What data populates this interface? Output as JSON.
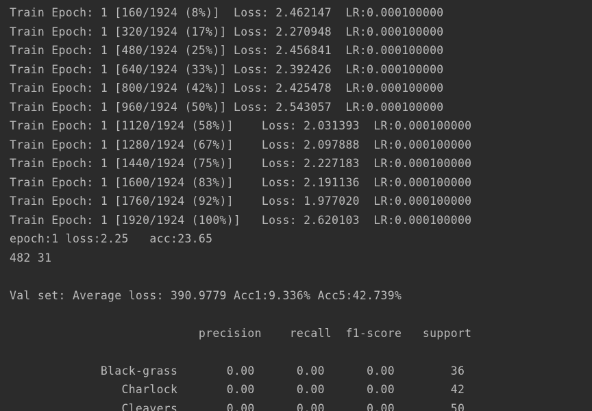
{
  "console": {
    "lines": [
      "Train Epoch: 1 [160/1924 (8%)]  Loss: 2.462147  LR:0.000100000",
      "Train Epoch: 1 [320/1924 (17%)] Loss: 2.270948  LR:0.000100000",
      "Train Epoch: 1 [480/1924 (25%)] Loss: 2.456841  LR:0.000100000",
      "Train Epoch: 1 [640/1924 (33%)] Loss: 2.392426  LR:0.000100000",
      "Train Epoch: 1 [800/1924 (42%)] Loss: 2.425478  LR:0.000100000",
      "Train Epoch: 1 [960/1924 (50%)] Loss: 2.543057  LR:0.000100000",
      "Train Epoch: 1 [1120/1924 (58%)]    Loss: 2.031393  LR:0.000100000",
      "Train Epoch: 1 [1280/1924 (67%)]    Loss: 2.097888  LR:0.000100000",
      "Train Epoch: 1 [1440/1924 (75%)]    Loss: 2.227183  LR:0.000100000",
      "Train Epoch: 1 [1600/1924 (83%)]    Loss: 2.191136  LR:0.000100000",
      "Train Epoch: 1 [1760/1924 (92%)]    Loss: 1.977020  LR:0.000100000",
      "Train Epoch: 1 [1920/1924 (100%)]   Loss: 2.620103  LR:0.000100000",
      "epoch:1 loss:2.25   acc:23.65",
      "482 31",
      "",
      "Val set: Average loss: 390.9779 Acc1:9.336% Acc5:42.739%",
      "",
      "                           precision    recall  f1-score   support",
      "",
      "             Black-grass       0.00      0.00      0.00        36",
      "                Charlock       0.00      0.00      0.00        42",
      "                Cleavers       0.00      0.00      0.00        50"
    ]
  }
}
